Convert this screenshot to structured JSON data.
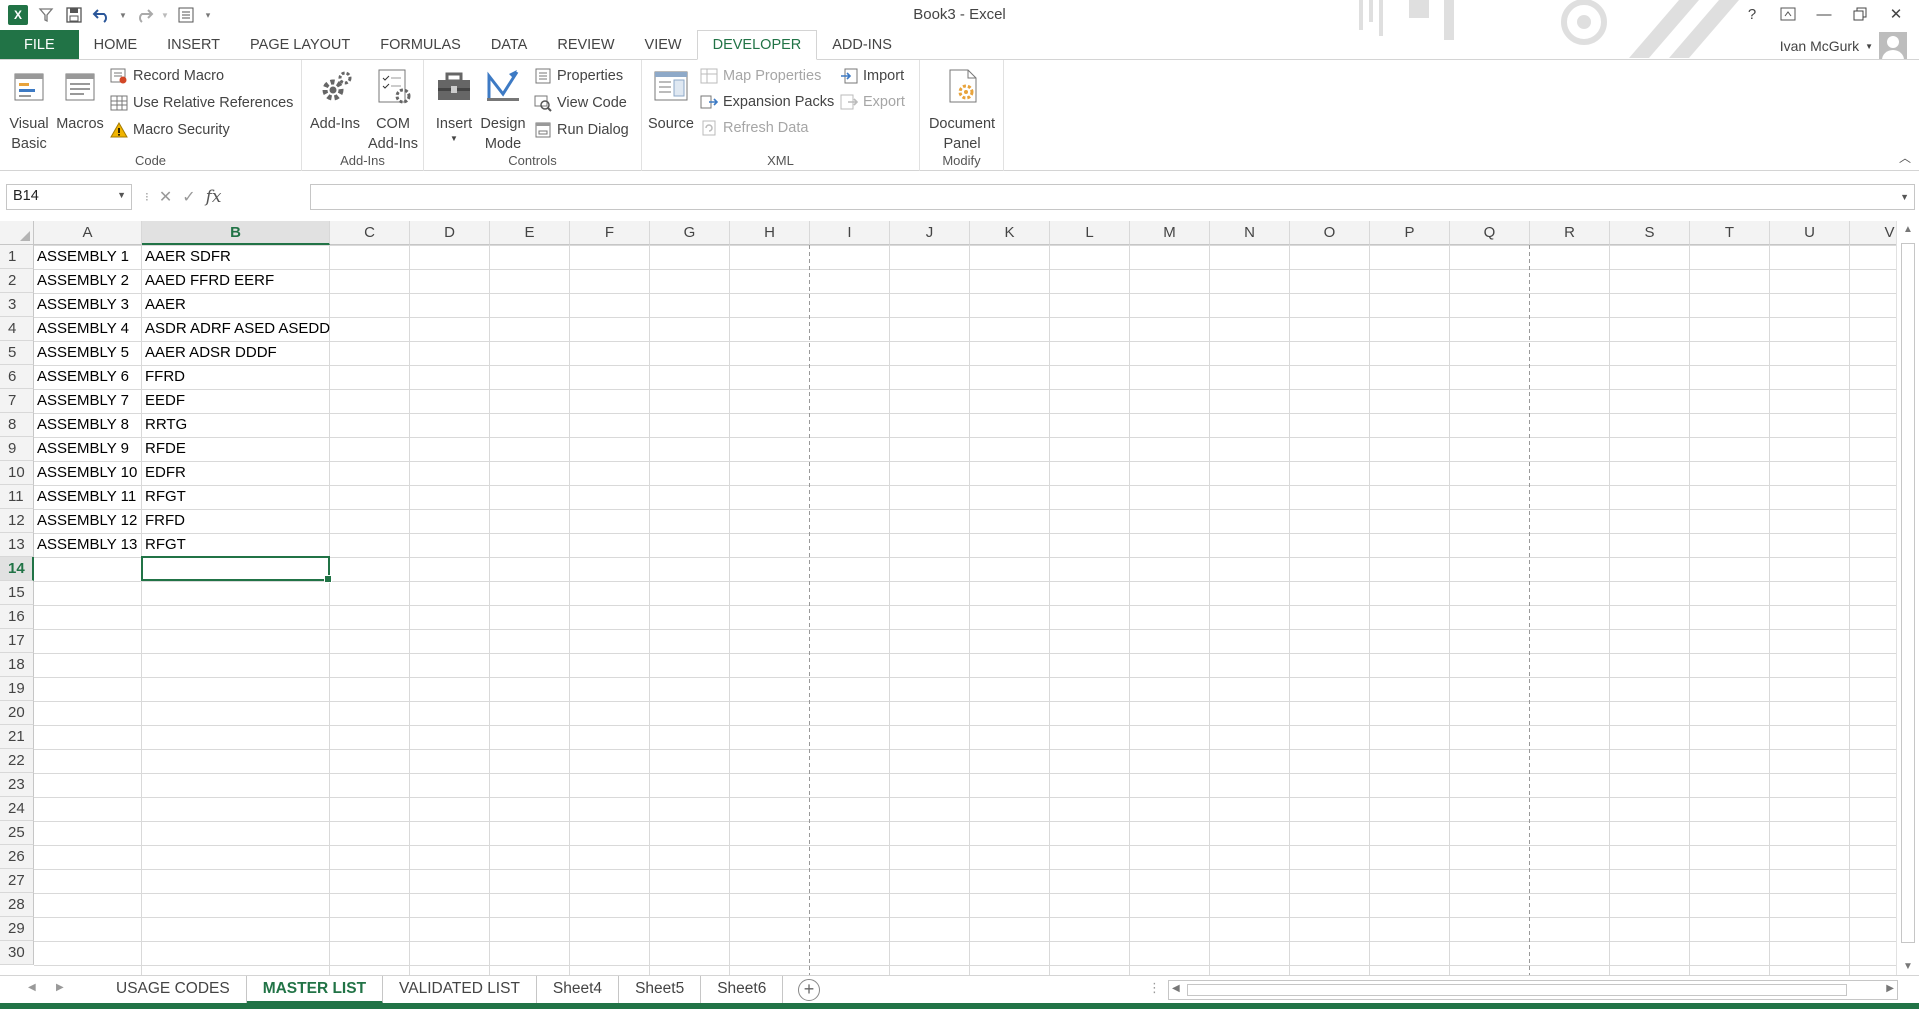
{
  "window": {
    "title": "Book3 - Excel",
    "help": "?",
    "user_name": "Ivan McGurk"
  },
  "colors": {
    "accent": "#217346",
    "disabled": "#a6a6a6"
  },
  "ribbon_tabs": [
    {
      "label": "FILE"
    },
    {
      "label": "HOME"
    },
    {
      "label": "INSERT"
    },
    {
      "label": "PAGE LAYOUT"
    },
    {
      "label": "FORMULAS"
    },
    {
      "label": "DATA"
    },
    {
      "label": "REVIEW"
    },
    {
      "label": "VIEW"
    },
    {
      "label": "DEVELOPER",
      "active": true
    },
    {
      "label": "ADD-INS"
    }
  ],
  "ribbon": {
    "code": {
      "label": "Code",
      "visual_basic": "Visual Basic",
      "macros": "Macros",
      "record_macro": "Record Macro",
      "relative_refs": "Use Relative References",
      "macro_security": "Macro Security"
    },
    "addins": {
      "label": "Add-Ins",
      "addins": "Add-Ins",
      "com_addins": "COM Add-Ins"
    },
    "controls": {
      "label": "Controls",
      "insert": "Insert",
      "design_mode": "Design Mode",
      "properties": "Properties",
      "view_code": "View Code",
      "run_dialog": "Run Dialog"
    },
    "xml": {
      "label": "XML",
      "source": "Source",
      "map_properties": "Map Properties",
      "expansion_packs": "Expansion Packs",
      "refresh_data": "Refresh Data",
      "import": "Import",
      "export": "Export"
    },
    "modify": {
      "label": "Modify",
      "document_panel": "Document Panel"
    }
  },
  "formula_bar": {
    "name_box": "B14",
    "formula": "",
    "fx": "fx"
  },
  "sheet": {
    "columns": [
      "A",
      "B",
      "C",
      "D",
      "E",
      "F",
      "G",
      "H",
      "I",
      "J",
      "K",
      "L",
      "M",
      "N",
      "O",
      "P",
      "Q",
      "R",
      "S",
      "T",
      "U",
      "V"
    ],
    "selected_column": "B",
    "selected_row": 14,
    "active_cell": "B14",
    "row_count": 30,
    "rows": [
      {
        "row": 1,
        "A": "ASSEMBLY 1",
        "B": "AAER SDFR"
      },
      {
        "row": 2,
        "A": "ASSEMBLY 2",
        "B": "AAED FFRD EERF"
      },
      {
        "row": 3,
        "A": "ASSEMBLY 3",
        "B": "AAER"
      },
      {
        "row": 4,
        "A": "ASSEMBLY 4",
        "B": "ASDR ADRF ASED ASEDD"
      },
      {
        "row": 5,
        "A": "ASSEMBLY 5",
        "B": "AAER ADSR DDDF"
      },
      {
        "row": 6,
        "A": "ASSEMBLY 6",
        "B": "FFRD"
      },
      {
        "row": 7,
        "A": "ASSEMBLY 7",
        "B": "EEDF"
      },
      {
        "row": 8,
        "A": "ASSEMBLY 8",
        "B": "RRTG"
      },
      {
        "row": 9,
        "A": "ASSEMBLY 9",
        "B": "RFDE"
      },
      {
        "row": 10,
        "A": "ASSEMBLY 10",
        "B": "EDFR"
      },
      {
        "row": 11,
        "A": "ASSEMBLY 11",
        "B": "RFGT"
      },
      {
        "row": 12,
        "A": "ASSEMBLY 12",
        "B": "FRFD"
      },
      {
        "row": 13,
        "A": "ASSEMBLY 13",
        "B": "RFGT"
      }
    ]
  },
  "sheet_tabs": [
    {
      "label": "USAGE CODES"
    },
    {
      "label": "MASTER LIST",
      "active": true
    },
    {
      "label": "VALIDATED LIST"
    },
    {
      "label": "Sheet4"
    },
    {
      "label": "Sheet5"
    },
    {
      "label": "Sheet6"
    }
  ]
}
